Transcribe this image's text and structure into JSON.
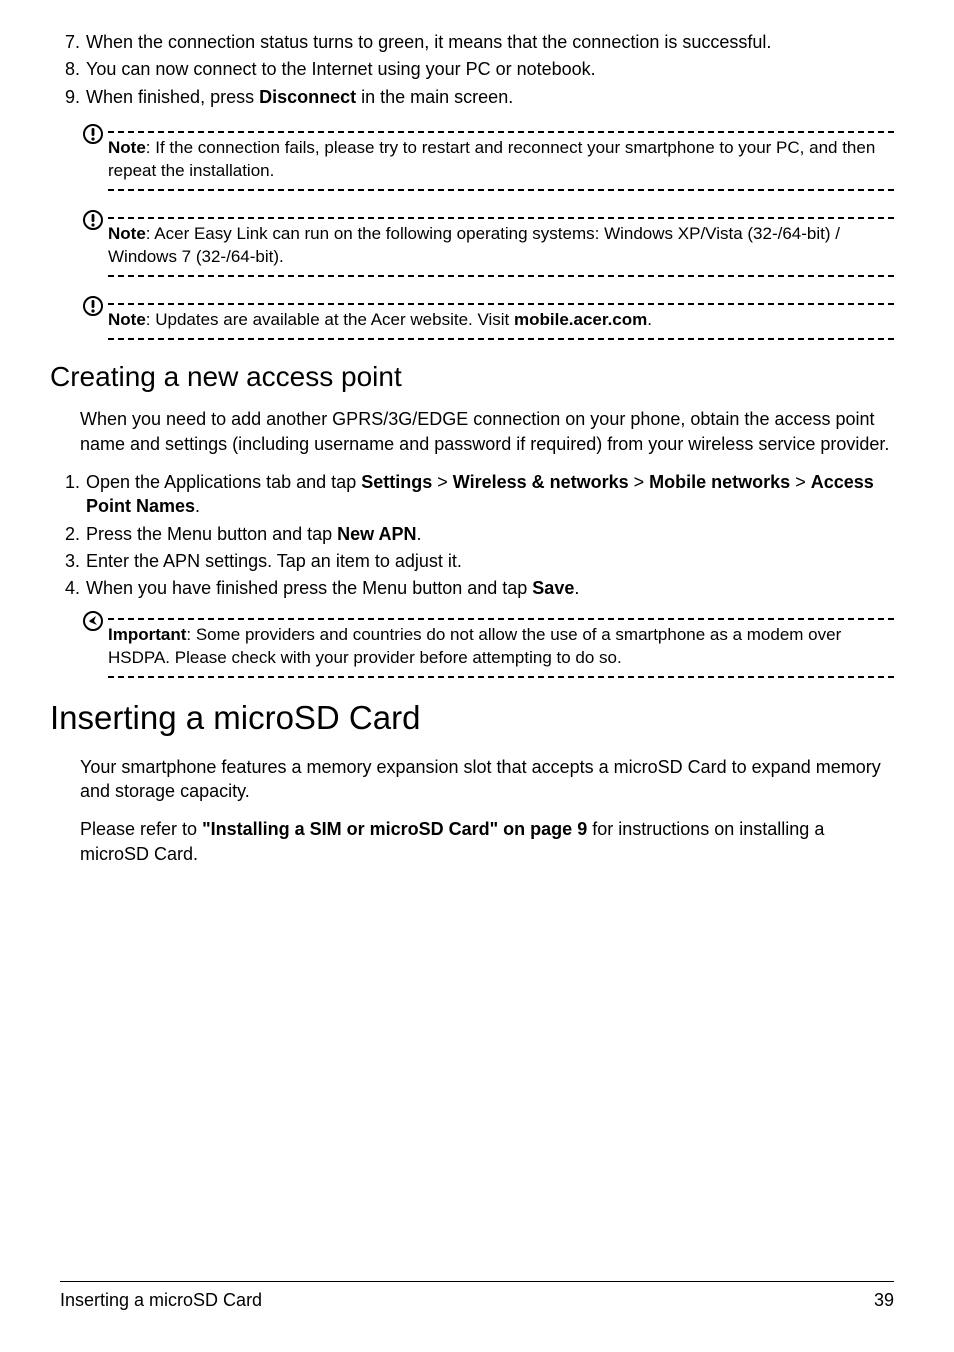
{
  "steps_top": [
    {
      "num": "7.",
      "text_parts": [
        "When the connection status turns to green, it means that the connection is successful."
      ]
    },
    {
      "num": "8.",
      "text_parts": [
        "You can now connect to the Internet using your PC or notebook."
      ]
    },
    {
      "num": "9.",
      "text_parts": [
        "When finished, press ",
        {
          "b": "Disconnect"
        },
        " in the main screen."
      ]
    }
  ],
  "note1": {
    "label": "Note",
    "text": ": If the connection fails, please try to restart and reconnect your smartphone to your PC, and then repeat the installation."
  },
  "note2": {
    "label": "Note",
    "text": ": Acer Easy Link can run on the following operating systems: Windows XP/Vista (32-/64-bit) / Windows 7 (32-/64-bit)."
  },
  "note3": {
    "label": "Note",
    "text_pre": ": Updates are available at the Acer website. Visit ",
    "link": "mobile.acer.com",
    "text_post": "."
  },
  "subhead1": "Creating a new access point",
  "para1": "When you need to add another GPRS/3G/EDGE connection on your phone, obtain the access point name and settings (including username and password if required) from your wireless service provider.",
  "steps_mid": [
    {
      "num": "1.",
      "parts": [
        "Open the Applications tab and tap ",
        {
          "b": "Settings"
        },
        " > ",
        {
          "b": "Wireless & networks"
        },
        " > ",
        {
          "b": "Mobile networks"
        },
        " > ",
        {
          "b": "Access Point Names"
        },
        "."
      ]
    },
    {
      "num": "2.",
      "parts": [
        "Press the Menu button and tap ",
        {
          "b": "New APN"
        },
        "."
      ]
    },
    {
      "num": "3.",
      "parts": [
        "Enter the APN settings. Tap an item to adjust it."
      ]
    },
    {
      "num": "4.",
      "parts": [
        "When you have finished press the Menu button and tap ",
        {
          "b": "Save"
        },
        "."
      ]
    }
  ],
  "important": {
    "label": "Important",
    "text": ": Some providers and countries do not allow the use of a smartphone as a modem over HSDPA. Please check with your provider before attempting to do so."
  },
  "sectionhead": "Inserting a microSD Card",
  "para2": "Your smartphone features a memory expansion slot that accepts a microSD Card to expand memory and storage capacity.",
  "para3_pre": "Please refer to ",
  "para3_link": "\"Installing a SIM or microSD Card\" on page 9",
  "para3_post": " for instructions on installing a microSD Card.",
  "footer_left": "Inserting a microSD Card",
  "footer_right": "39"
}
